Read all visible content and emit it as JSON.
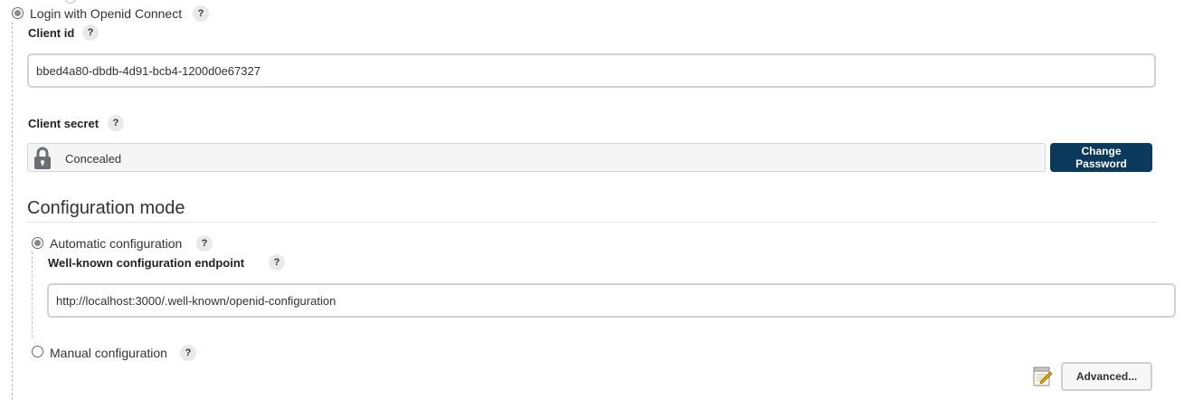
{
  "oidc_option": {
    "label": "Login with Openid Connect",
    "help": "?",
    "selected": true
  },
  "client_id": {
    "label": "Client id",
    "help": "?",
    "value": "bbed4a80-dbdb-4d91-bcb4-1200d0e67327"
  },
  "client_secret": {
    "label": "Client secret",
    "help": "?",
    "value": "Concealed",
    "icon": "lock-icon",
    "change_button": "Change Password"
  },
  "configuration_mode": {
    "heading": "Configuration mode",
    "automatic": {
      "label": "Automatic configuration",
      "help": "?",
      "selected": true,
      "endpoint": {
        "label": "Well-known configuration endpoint",
        "help": "?",
        "value": "http://localhost:3000/.well-known/openid-configuration"
      }
    },
    "manual": {
      "label": "Manual configuration",
      "help": "?",
      "selected": false
    }
  },
  "advanced": {
    "icon": "notepad-edit-icon",
    "button": "Advanced..."
  },
  "colors": {
    "primary_button": "#0b3a5c",
    "help_bg": "#e9e9e9",
    "input_border": "#d2d2d2"
  }
}
